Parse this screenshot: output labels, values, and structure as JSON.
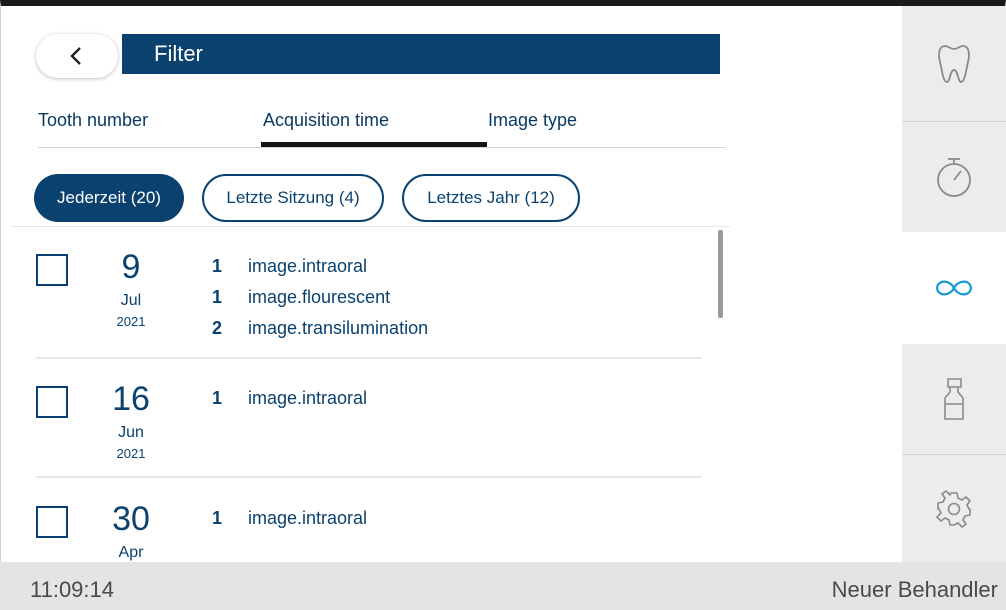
{
  "header": {
    "title": "Filter"
  },
  "tabs": [
    {
      "label": "Tooth number"
    },
    {
      "label": "Acquisition time"
    },
    {
      "label": "Image type"
    }
  ],
  "filters": [
    {
      "label": "Jederzeit (20)"
    },
    {
      "label": "Letzte Sitzung (4)"
    },
    {
      "label": "Letztes Jahr (12)"
    }
  ],
  "entries": [
    {
      "day": "9",
      "month": "Jul",
      "year": "2021",
      "items": [
        {
          "count": "1",
          "type": "image.intraoral"
        },
        {
          "count": "1",
          "type": "image.flourescent"
        },
        {
          "count": "2",
          "type": "image.transilumination"
        }
      ]
    },
    {
      "day": "16",
      "month": "Jun",
      "year": "2021",
      "items": [
        {
          "count": "1",
          "type": "image.intraoral"
        }
      ]
    },
    {
      "day": "30",
      "month": "Apr",
      "year": "",
      "items": [
        {
          "count": "1",
          "type": "image.intraoral"
        }
      ]
    }
  ],
  "sidebar": {
    "items": [
      {
        "icon": "tooth-icon"
      },
      {
        "icon": "timer-icon"
      },
      {
        "icon": "infinity-icon"
      },
      {
        "icon": "spray-bottle-icon"
      },
      {
        "icon": "settings-icon"
      }
    ]
  },
  "status": {
    "time": "11:09:14",
    "user": "Neuer Behandler"
  },
  "colors": {
    "primary": "#0b416e",
    "active_icon": "#1a9ad6"
  }
}
